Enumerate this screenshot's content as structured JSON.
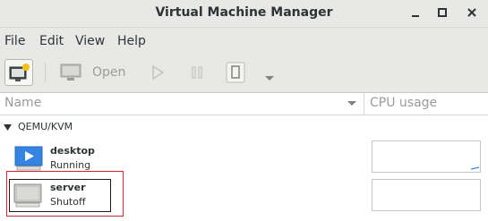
{
  "window": {
    "title": "Virtual Machine Manager"
  },
  "menu": {
    "items": [
      "File",
      "Edit",
      "View",
      "Help"
    ]
  },
  "toolbar": {
    "open_label": "Open"
  },
  "columns": {
    "name": "Name",
    "cpu": "CPU usage"
  },
  "connection": {
    "label": "QEMU/KVM"
  },
  "vms": [
    {
      "name": "desktop",
      "status": "Running"
    },
    {
      "name": "server",
      "status": "Shutoff"
    }
  ],
  "colors": {
    "highlight": "#c9272f",
    "running_accent": "#3584e4"
  }
}
